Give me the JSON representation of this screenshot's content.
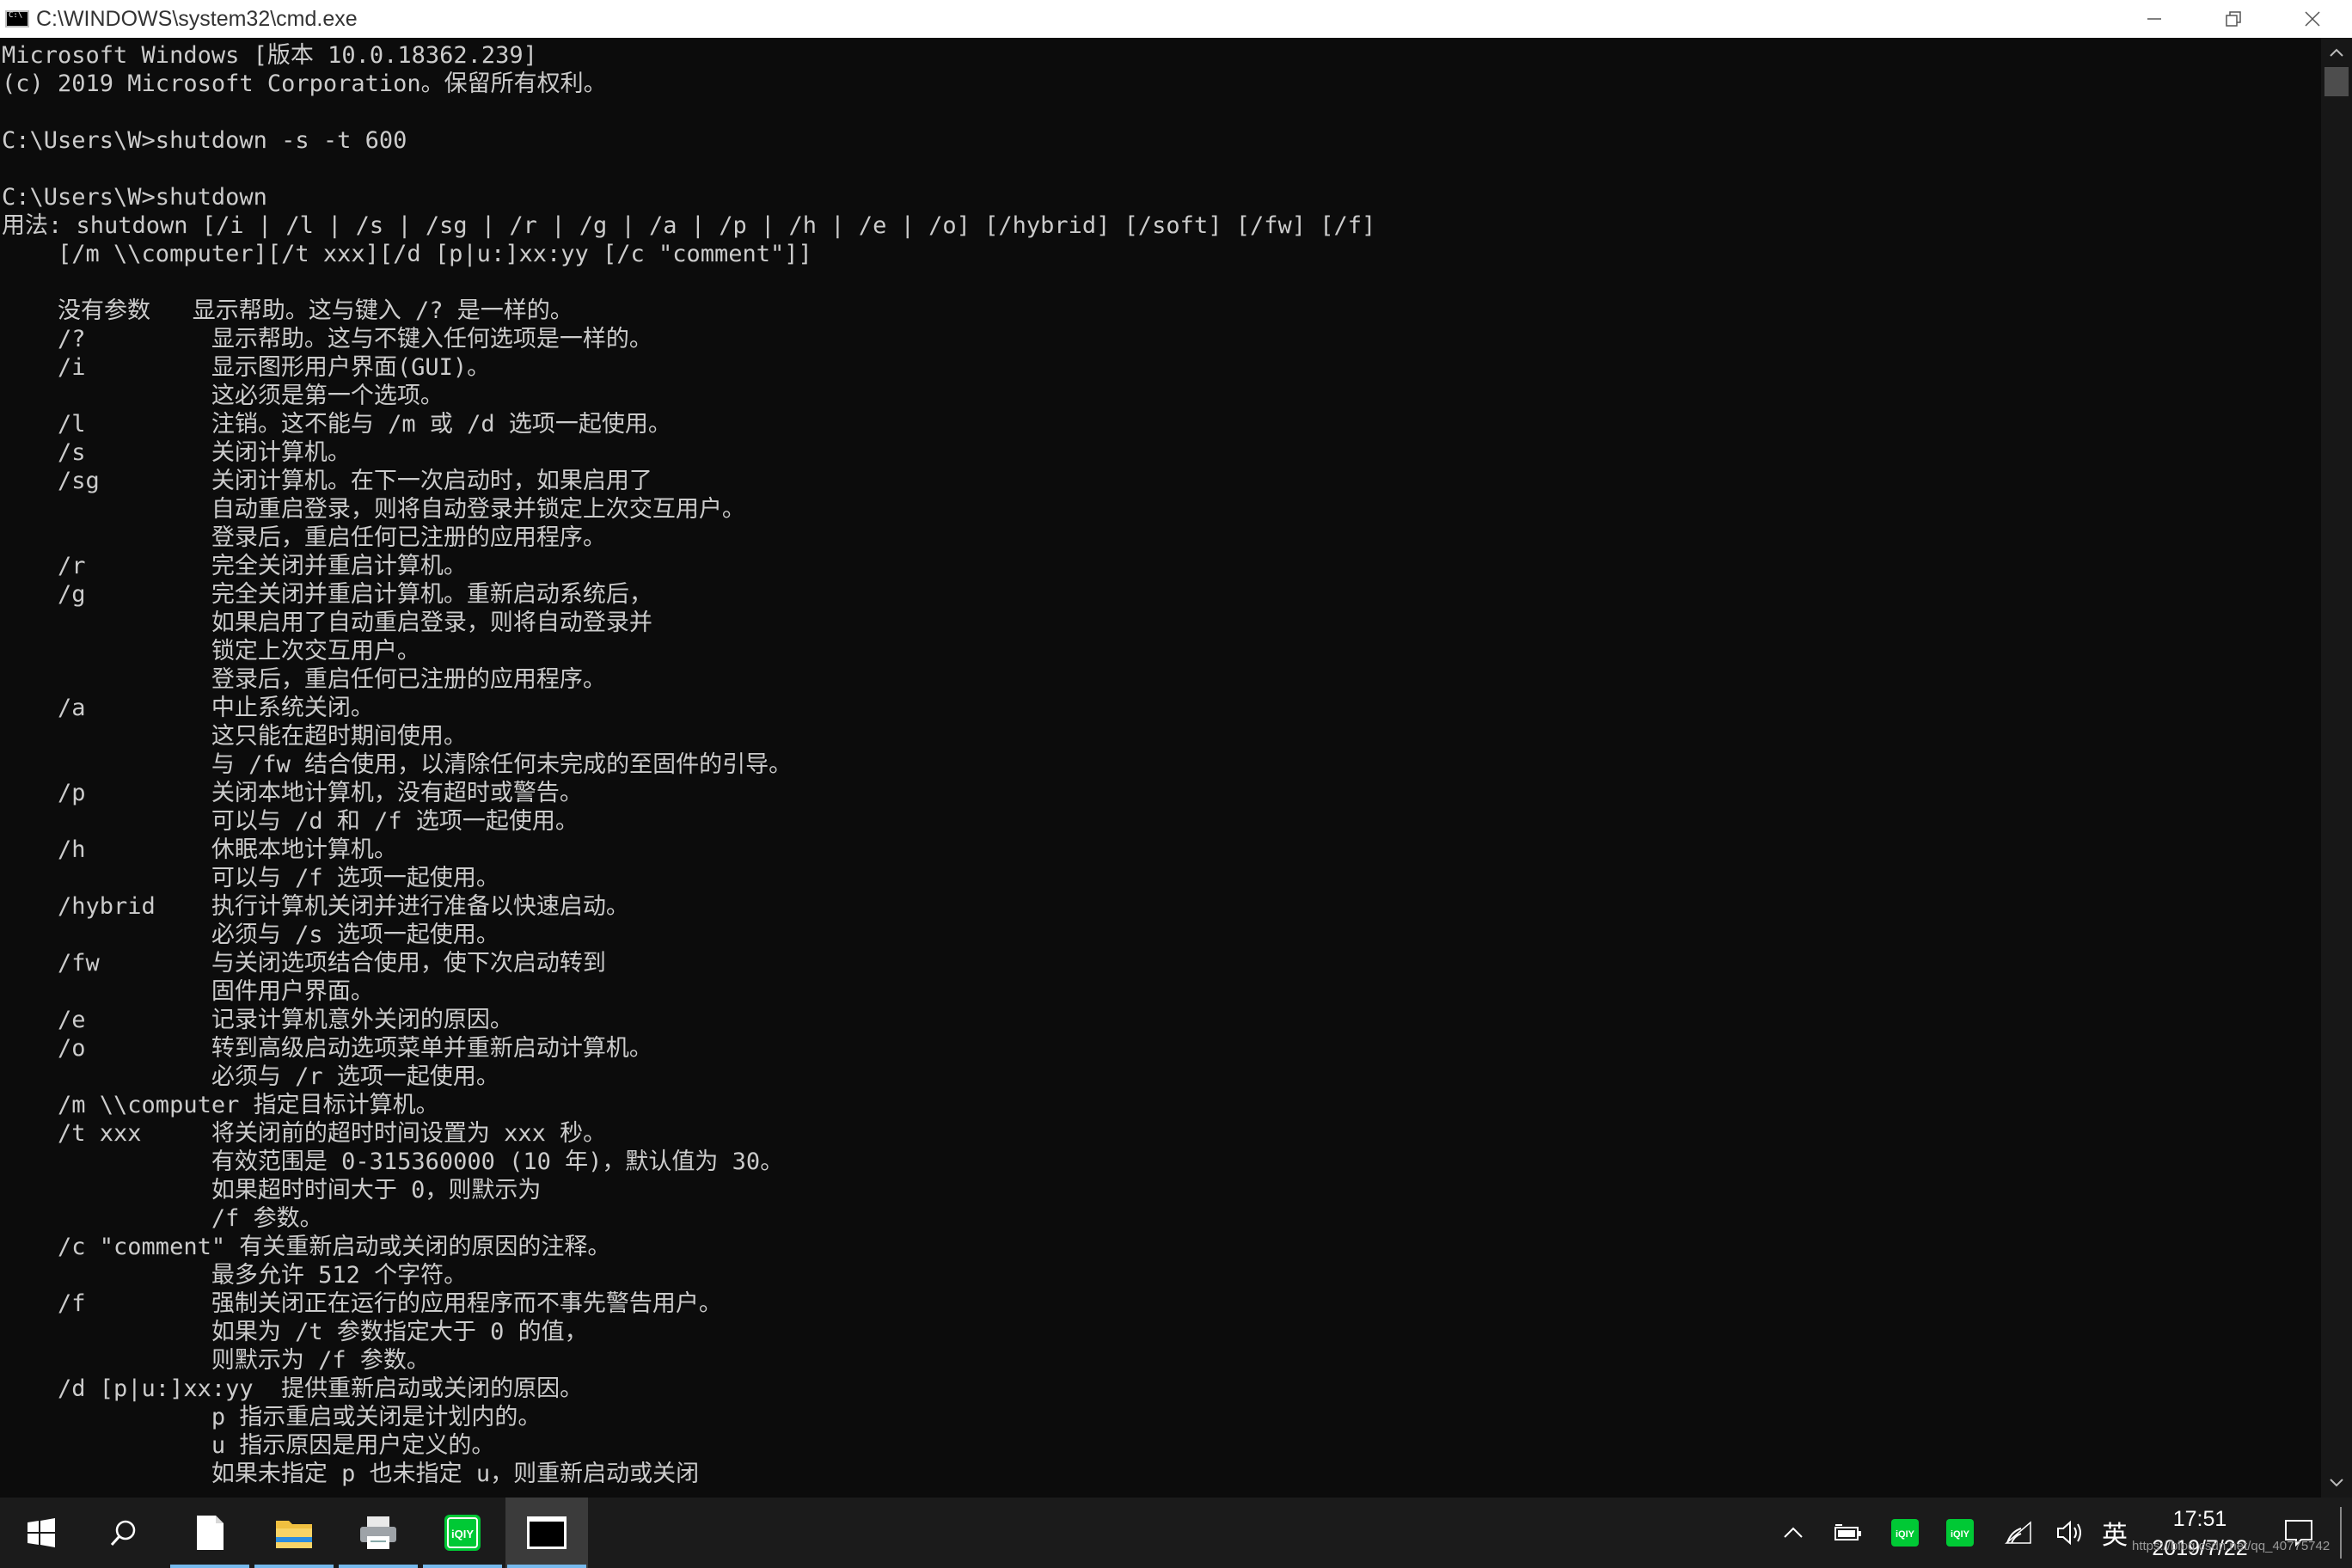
{
  "window": {
    "title": "C:\\WINDOWS\\system32\\cmd.exe",
    "icon": "cmd-icon"
  },
  "console": {
    "lines": [
      "Microsoft Windows [版本 10.0.18362.239]",
      "(c) 2019 Microsoft Corporation。保留所有权利。",
      "",
      "C:\\Users\\W>shutdown -s -t 600",
      "",
      "C:\\Users\\W>shutdown",
      "用法: shutdown [/i | /l | /s | /sg | /r | /g | /a | /p | /h | /e | /o] [/hybrid] [/soft] [/fw] [/f]",
      "    [/m \\\\computer][/t xxx][/d [p|u:]xx:yy [/c \"comment\"]]",
      "",
      "    没有参数   显示帮助。这与键入 /? 是一样的。",
      "    /?         显示帮助。这与不键入任何选项是一样的。",
      "    /i         显示图形用户界面(GUI)。",
      "               这必须是第一个选项。",
      "    /l         注销。这不能与 /m 或 /d 选项一起使用。",
      "    /s         关闭计算机。",
      "    /sg        关闭计算机。在下一次启动时，如果启用了",
      "               自动重启登录，则将自动登录并锁定上次交互用户。",
      "               登录后，重启任何已注册的应用程序。",
      "    /r         完全关闭并重启计算机。",
      "    /g         完全关闭并重启计算机。重新启动系统后，",
      "               如果启用了自动重启登录，则将自动登录并",
      "               锁定上次交互用户。",
      "               登录后，重启任何已注册的应用程序。",
      "    /a         中止系统关闭。",
      "               这只能在超时期间使用。",
      "               与 /fw 结合使用，以清除任何未完成的至固件的引导。",
      "    /p         关闭本地计算机，没有超时或警告。",
      "               可以与 /d 和 /f 选项一起使用。",
      "    /h         休眠本地计算机。",
      "               可以与 /f 选项一起使用。",
      "    /hybrid    执行计算机关闭并进行准备以快速启动。",
      "               必须与 /s 选项一起使用。",
      "    /fw        与关闭选项结合使用，使下次启动转到",
      "               固件用户界面。",
      "    /e         记录计算机意外关闭的原因。",
      "    /o         转到高级启动选项菜单并重新启动计算机。",
      "               必须与 /r 选项一起使用。",
      "    /m \\\\computer 指定目标计算机。",
      "    /t xxx     将关闭前的超时时间设置为 xxx 秒。",
      "               有效范围是 0-315360000 (10 年)，默认值为 30。",
      "               如果超时时间大于 0，则默示为",
      "               /f 参数。",
      "    /c \"comment\" 有关重新启动或关闭的原因的注释。",
      "               最多允许 512 个字符。",
      "    /f         强制关闭正在运行的应用程序而不事先警告用户。",
      "               如果为 /t 参数指定大于 0 的值，",
      "               则默示为 /f 参数。",
      "    /d [p|u:]xx:yy  提供重新启动或关闭的原因。",
      "               p 指示重启或关闭是计划内的。",
      "               u 指示原因是用户定义的。",
      "               如果未指定 p 也未指定 u，则重新启动或关闭"
    ]
  },
  "taskbar": {
    "apps": [
      {
        "name": "start-button",
        "icon": "windows-logo-icon"
      },
      {
        "name": "search-button",
        "icon": "search-icon"
      },
      {
        "name": "file-app",
        "icon": "document-icon"
      },
      {
        "name": "file-explorer",
        "icon": "folder-icon"
      },
      {
        "name": "app-4",
        "icon": "printer-icon"
      },
      {
        "name": "iqiyi",
        "icon": "iqiyi-icon"
      },
      {
        "name": "cmd",
        "icon": "terminal-icon"
      }
    ],
    "tray": {
      "ime": "英",
      "iqiyi_label": "iQIY",
      "time": "17:51",
      "date": "2019/7/22"
    },
    "watermark": "https://blog.csdn.net/qq_40775742"
  }
}
